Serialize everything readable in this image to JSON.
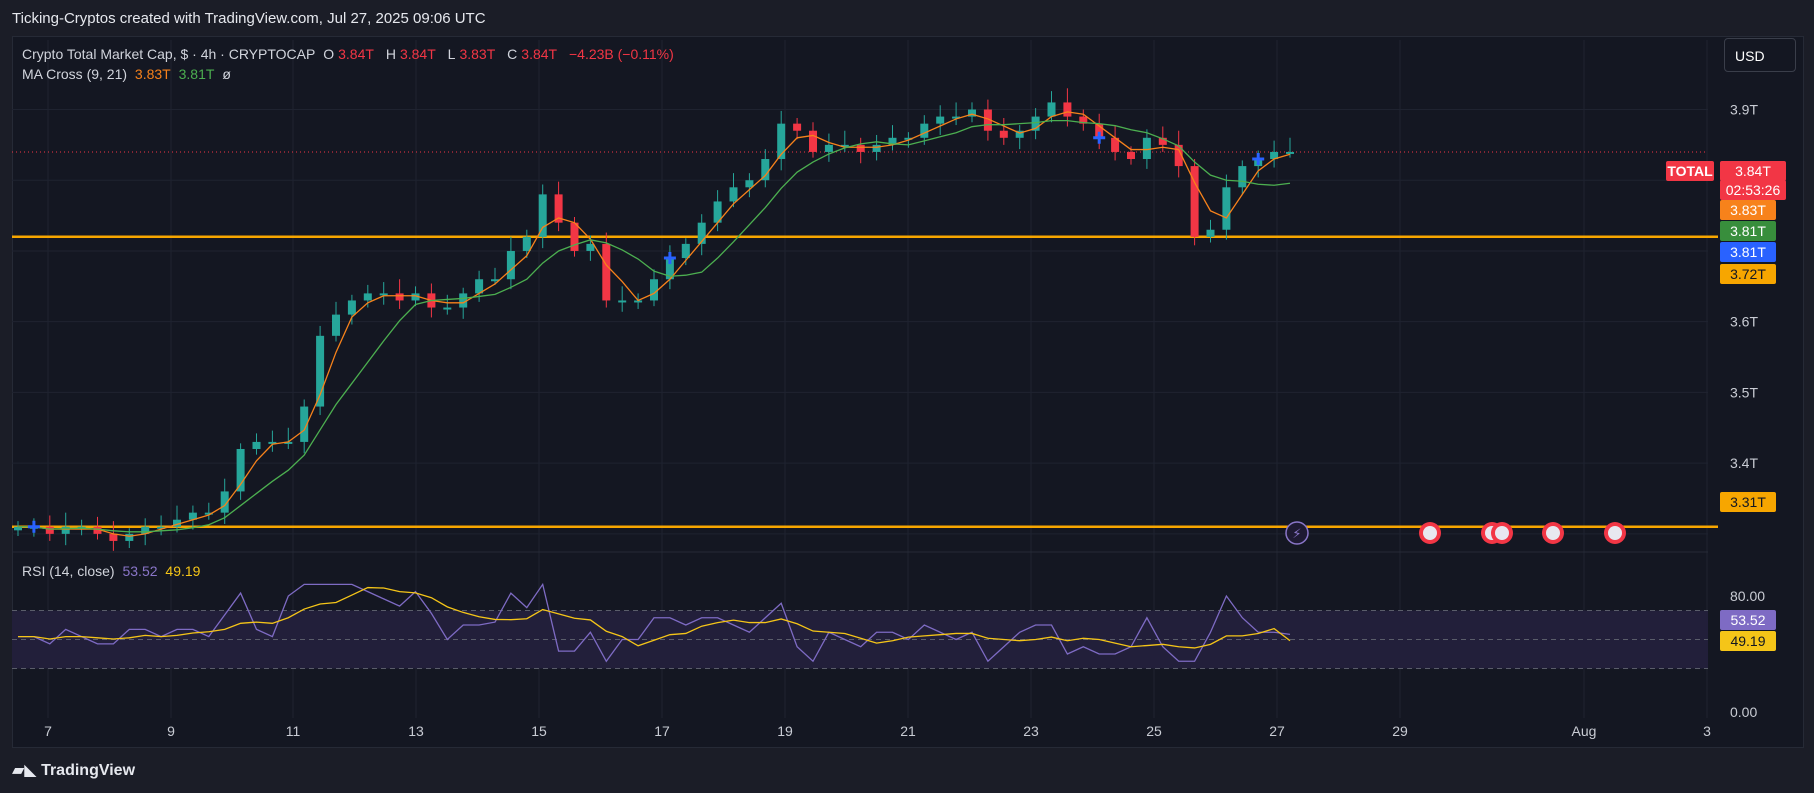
{
  "header": {
    "title": "Ticking-Cryptos created with TradingView.com, Jul 27, 2025 09:06 UTC"
  },
  "legend": {
    "symbol": "Crypto Total Market Cap, $ · 4h · CRYPTOCAP",
    "o_label": "O",
    "o_value": "3.84T",
    "h_label": "H",
    "h_value": "3.84T",
    "l_label": "L",
    "l_value": "3.83T",
    "c_label": "C",
    "c_value": "3.84T",
    "change": "−4.23B (−0.11%)",
    "ma_label": "MA Cross (9, 21)",
    "ma_fast": "3.83T",
    "ma_slow": "3.81T",
    "ma_extra": "ø",
    "rsi_label": "RSI (14, close)",
    "rsi_value": "53.52",
    "rsi_ma_value": "49.19"
  },
  "currency_button": "USD",
  "branding": "TradingView",
  "price_tags": {
    "total_label": "TOTAL",
    "last": "3.84T",
    "countdown": "02:53:26",
    "ma_fast": "3.83T",
    "ma_slow": "3.81T",
    "cross": "3.81T",
    "level_upper": "3.72T",
    "level_lower": "3.31T",
    "rsi": "53.52",
    "rsi_ma": "49.19"
  },
  "colors": {
    "up": "#26a69a",
    "down": "#f23645",
    "ma_fast": "#f7821b",
    "ma_slow": "#4caf50",
    "level": "#f7a600",
    "rsi": "#7e6bc4",
    "rsi_ma": "#f5c518",
    "cross_marker": "#2962ff"
  },
  "chart_data": [
    {
      "type": "candlestick",
      "interval": "4h",
      "x_labels": [
        "7",
        "9",
        "11",
        "13",
        "15",
        "17",
        "19",
        "21",
        "23",
        "25",
        "27",
        "29",
        "Aug",
        "3"
      ],
      "y_ticks": [
        "3.9T",
        "3.6T",
        "3.5T",
        "3.4T"
      ],
      "ylim": [
        3.28,
        3.97
      ],
      "horizontal_levels": [
        3.72,
        3.31
      ],
      "last_price": 3.84,
      "ohlc_close_path": [
        3.31,
        3.31,
        3.3,
        3.31,
        3.31,
        3.3,
        3.29,
        3.3,
        3.31,
        3.31,
        3.32,
        3.33,
        3.33,
        3.36,
        3.42,
        3.43,
        3.43,
        3.43,
        3.48,
        3.58,
        3.61,
        3.63,
        3.64,
        3.64,
        3.63,
        3.64,
        3.62,
        3.62,
        3.64,
        3.66,
        3.66,
        3.7,
        3.72,
        3.78,
        3.74,
        3.7,
        3.71,
        3.63,
        3.63,
        3.63,
        3.66,
        3.69,
        3.71,
        3.74,
        3.77,
        3.79,
        3.8,
        3.83,
        3.88,
        3.87,
        3.84,
        3.85,
        3.85,
        3.84,
        3.85,
        3.86,
        3.86,
        3.88,
        3.89,
        3.89,
        3.9,
        3.87,
        3.86,
        3.87,
        3.89,
        3.91,
        3.89,
        3.88,
        3.86,
        3.84,
        3.83,
        3.86,
        3.85,
        3.82,
        3.72,
        3.73,
        3.79,
        3.82,
        3.83,
        3.84,
        3.84
      ],
      "ma_cross_markers": [
        "7",
        "17",
        "23",
        "27"
      ]
    },
    {
      "type": "line",
      "title": "RSI (14, close)",
      "y_ticks": [
        "80.00",
        "0.00"
      ],
      "ylim": [
        0,
        100
      ],
      "band": [
        70,
        30
      ],
      "series": [
        {
          "name": "RSI",
          "last": 53.52
        },
        {
          "name": "RSI-based MA",
          "last": 49.19
        }
      ]
    }
  ]
}
